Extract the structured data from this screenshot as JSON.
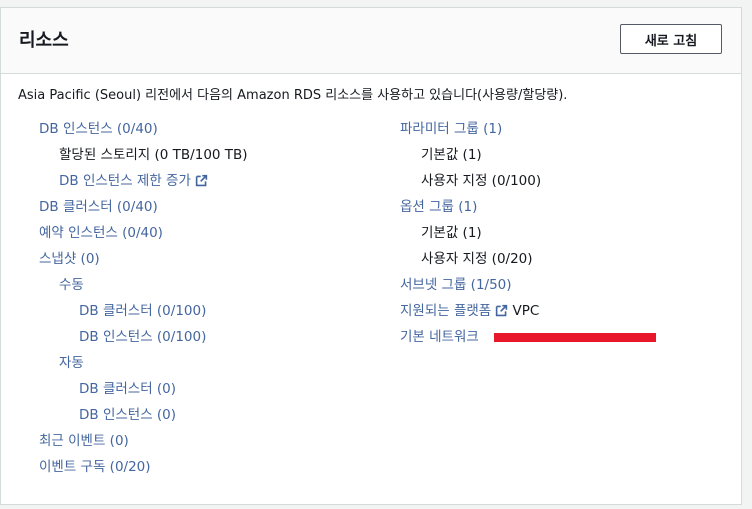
{
  "header": {
    "title": "리소스",
    "refresh_label": "새로 고침"
  },
  "intro": "Asia Pacific (Seoul) 리전에서 다음의 Amazon RDS 리소스를 사용하고 있습니다(사용량/할당량).",
  "left": {
    "db_instances": "DB 인스턴스 (0/40)",
    "allocated_storage": "할당된 스토리지 (0 TB/100 TB)",
    "increase_limit": "DB 인스턴스 제한 증가",
    "db_clusters": "DB 클러스터 (0/40)",
    "reserved_instances": "예약 인스턴스 (0/40)",
    "snapshots": "스냅샷 (0)",
    "manual": "수동",
    "manual_clusters": "DB 클러스터 (0/100)",
    "manual_instances": "DB 인스턴스 (0/100)",
    "automated": "자동",
    "auto_clusters": "DB 클러스터 (0)",
    "auto_instances": "DB 인스턴스 (0)",
    "recent_events": "최근 이벤트 (0)",
    "event_subscriptions": "이벤트 구독 (0/20)"
  },
  "right": {
    "parameter_groups": "파라미터 그룹 (1)",
    "pg_default": "기본값 (1)",
    "pg_custom": "사용자 지정 (0/100)",
    "option_groups": "옵션 그룹 (1)",
    "og_default": "기본값 (1)",
    "og_custom": "사용자 지정 (0/20)",
    "subnet_groups": "서브넷 그룹 (1/50)",
    "supported_platforms": "지원되는 플랫폼",
    "supported_platforms_value": "VPC",
    "default_network": "기본 네트워크"
  },
  "colors": {
    "link": "#44669f",
    "redaction": "#e8172b"
  }
}
